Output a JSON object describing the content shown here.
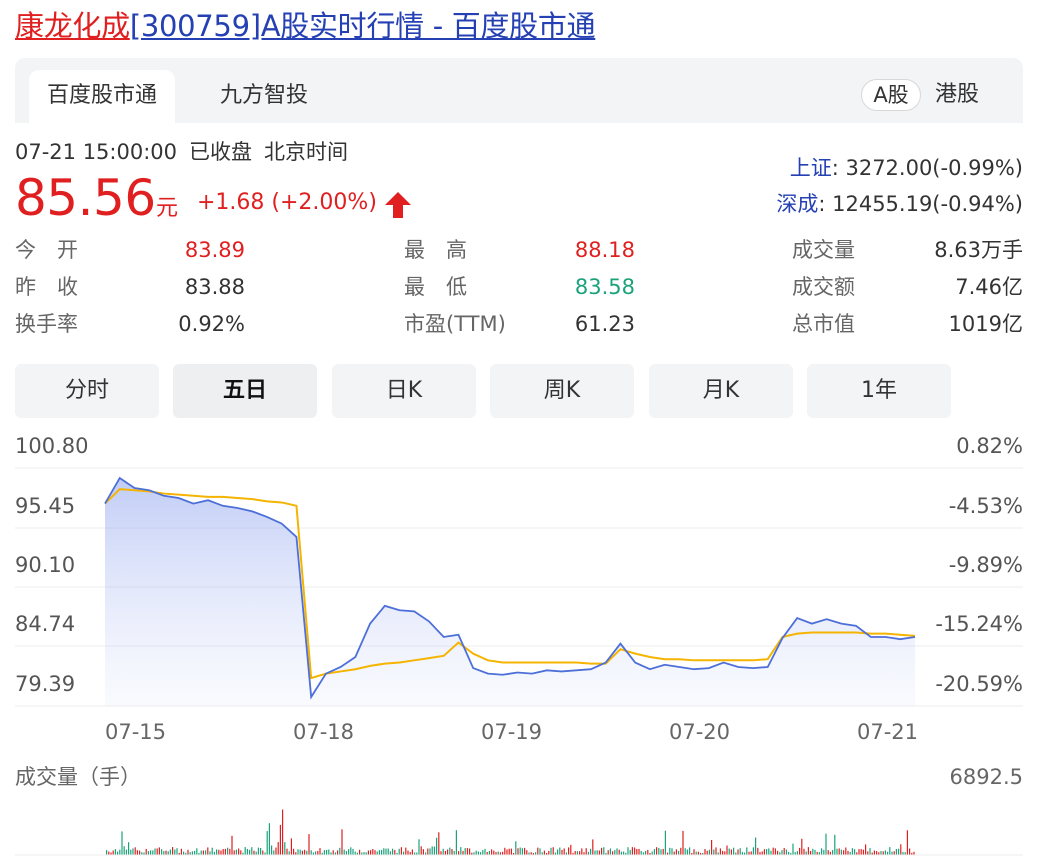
{
  "page": {
    "title_name": "康龙化成",
    "title_rest": "[300759]A股实时行情 - 百度股市通"
  },
  "tabs": [
    {
      "label": "百度股市通",
      "active": true
    },
    {
      "label": "九方智投",
      "active": false
    }
  ],
  "market": {
    "active": "A股",
    "other": "港股"
  },
  "status": {
    "time": "07-21 15:00:00",
    "state": "已收盘",
    "tz": "北京时间"
  },
  "quote": {
    "price": "85.56",
    "unit": "元",
    "change": "+1.68 (+2.00%)",
    "up_color": "#e02020",
    "down_color": "#1aa37a"
  },
  "indices": [
    {
      "label": "上证",
      "value": ": 3272.00(-0.99%)"
    },
    {
      "label": "深成",
      "value": ": 12455.19(-0.94%)"
    }
  ],
  "stats": [
    {
      "label": "今　开",
      "value": "83.89",
      "color": "red"
    },
    {
      "label": "昨　收",
      "value": "83.88",
      "color": "plain"
    },
    {
      "label": "换手率",
      "value": "0.92%",
      "color": "plain"
    },
    {
      "label": "最　高",
      "value": "88.18",
      "color": "red"
    },
    {
      "label": "最　低",
      "value": "83.58",
      "color": "green"
    },
    {
      "label": "市盈(TTM)",
      "value": "61.23",
      "color": "plain"
    },
    {
      "label": "成交量",
      "value": "8.63万手",
      "color": "plain"
    },
    {
      "label": "成交额",
      "value": "7.46亿",
      "color": "plain"
    },
    {
      "label": "总市值",
      "value": "1019亿",
      "color": "plain"
    }
  ],
  "period_tabs": [
    {
      "label": "分时",
      "active": false
    },
    {
      "label": "五日",
      "active": true
    },
    {
      "label": "日K",
      "active": false
    },
    {
      "label": "周K",
      "active": false
    },
    {
      "label": "月K",
      "active": false
    },
    {
      "label": "1年",
      "active": false
    }
  ],
  "chart_data": {
    "type": "line",
    "ylim": [
      79.39,
      100.8
    ],
    "y_ticks": [
      "100.80",
      "95.45",
      "90.10",
      "84.74",
      "79.39"
    ],
    "pct_ticks": [
      "0.82%",
      "-4.53%",
      "-9.89%",
      "-15.24%",
      "-20.59%"
    ],
    "x_ticks": [
      "07-15",
      "07-18",
      "07-19",
      "07-20",
      "07-21"
    ],
    "grid": true,
    "price_color": "#4d6fd8",
    "avg_color": "#f4b400",
    "price_series": [
      97.6,
      99.9,
      99.0,
      98.8,
      98.3,
      98.1,
      97.6,
      97.9,
      97.4,
      97.2,
      96.9,
      96.4,
      95.8,
      94.6,
      80.2,
      82.3,
      82.9,
      83.8,
      86.8,
      88.4,
      88.0,
      87.9,
      87.0,
      85.6,
      85.8,
      82.8,
      82.3,
      82.2,
      82.4,
      82.3,
      82.6,
      82.5,
      82.6,
      82.7,
      83.3,
      85.0,
      83.3,
      82.7,
      83.1,
      82.9,
      82.7,
      82.8,
      83.3,
      82.9,
      82.8,
      82.9,
      85.5,
      87.3,
      86.8,
      87.2,
      86.8,
      86.6,
      85.6,
      85.6,
      85.4,
      85.6
    ],
    "avg_series": [
      97.6,
      98.9,
      98.8,
      98.7,
      98.5,
      98.4,
      98.3,
      98.2,
      98.2,
      98.1,
      98.0,
      97.8,
      97.7,
      97.4,
      81.9,
      82.3,
      82.5,
      82.7,
      83.0,
      83.2,
      83.3,
      83.5,
      83.7,
      83.9,
      85.1,
      84.1,
      83.5,
      83.3,
      83.3,
      83.3,
      83.3,
      83.3,
      83.3,
      83.2,
      83.2,
      84.5,
      84.1,
      83.8,
      83.6,
      83.6,
      83.5,
      83.5,
      83.5,
      83.5,
      83.5,
      83.6,
      85.6,
      85.9,
      86.0,
      86.0,
      86.0,
      86.0,
      85.9,
      85.9,
      85.8,
      85.7
    ],
    "volume_title": "成交量（手）",
    "volume_max": "6892.5"
  }
}
